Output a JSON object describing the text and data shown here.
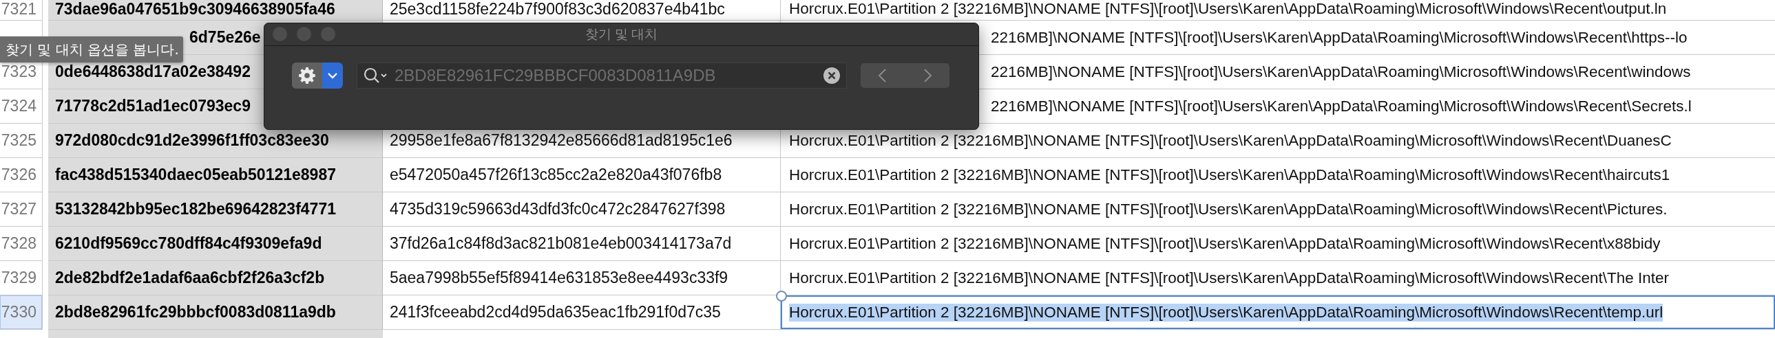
{
  "sheet": {
    "rows": [
      {
        "number": "7321",
        "selected": false,
        "column_1": "73dae96a047651b9c30946638905fa46",
        "column_2": "25e3cd1158fe224b7f900f83c3d620837e4b41bc",
        "column_3": "Horcrux.E01\\Partition 2 [32216MB]\\NONAME [NTFS]\\[root]\\Users\\Karen\\AppData\\Roaming\\Microsoft\\Windows\\Recent\\output.ln"
      },
      {
        "selected": false,
        "column_1": "6d75e26e",
        "column_3": "2216MB]\\NONAME [NTFS]\\[root]\\Users\\Karen\\AppData\\Roaming\\Microsoft\\Windows\\Recent\\https--lo"
      },
      {
        "number": "7323",
        "selected": false,
        "column_1": "0de6448638d17a02e38492",
        "column_3": "2216MB]\\NONAME [NTFS]\\[root]\\Users\\Karen\\AppData\\Roaming\\Microsoft\\Windows\\Recent\\windows"
      },
      {
        "number": "7324",
        "selected": false,
        "column_1": "71778c2d51ad1ec0793ec9",
        "column_3": "2216MB]\\NONAME [NTFS]\\[root]\\Users\\Karen\\AppData\\Roaming\\Microsoft\\Windows\\Recent\\Secrets.l"
      },
      {
        "number": "7325",
        "selected": false,
        "column_1": "972d080cdc91d2e3996f1ff03c83ee30",
        "column_2": "29958e1fe8a67f8132942e85666d81ad8195c1e6",
        "column_3": "Horcrux.E01\\Partition 2 [32216MB]\\NONAME [NTFS]\\[root]\\Users\\Karen\\AppData\\Roaming\\Microsoft\\Windows\\Recent\\DuanesC"
      },
      {
        "number": "7326",
        "selected": false,
        "column_1": "fac438d515340daec05eab50121e8987",
        "column_2": "e5472050a457f26f13c85cc2a2e820a43f076fb8",
        "column_3": "Horcrux.E01\\Partition 2 [32216MB]\\NONAME [NTFS]\\[root]\\Users\\Karen\\AppData\\Roaming\\Microsoft\\Windows\\Recent\\haircuts1"
      },
      {
        "number": "7327",
        "selected": false,
        "column_1": "53132842bb95ec182be69642823f4771",
        "column_2": "4735d319c59663d43dfd3fc0c472c2847627f398",
        "column_3": "Horcrux.E01\\Partition 2 [32216MB]\\NONAME [NTFS]\\[root]\\Users\\Karen\\AppData\\Roaming\\Microsoft\\Windows\\Recent\\Pictures."
      },
      {
        "number": "7328",
        "selected": false,
        "column_1": "6210df9569cc780dff84c4f9309efa9d",
        "column_2": "37fd26a1c84f8d3ac821b081e4eb003414173a7d",
        "column_3": "Horcrux.E01\\Partition 2 [32216MB]\\NONAME [NTFS]\\[root]\\Users\\Karen\\AppData\\Roaming\\Microsoft\\Windows\\Recent\\x88bidy"
      },
      {
        "number": "7329",
        "selected": false,
        "column_1": "2de82bdf2e1adaf6aa6cbf2f26a3cf2b",
        "column_2": "5aea7998b55ef5f89414e631853e8ee4493c33f9",
        "column_3": "Horcrux.E01\\Partition 2 [32216MB]\\NONAME [NTFS]\\[root]\\Users\\Karen\\AppData\\Roaming\\Microsoft\\Windows\\Recent\\The Inter"
      },
      {
        "number": "7330",
        "selected": true,
        "column_1": "2bd8e82961fc29bbbcf0083d0811a9db",
        "column_2": "241f3fceeabd2cd4d95da635eac1fb291f0d7c35",
        "column_3": "Horcrux.E01\\Partition 2 [32216MB]\\NONAME [NTFS]\\[root]\\Users\\Karen\\AppData\\Roaming\\Microsoft\\Windows\\Recent\\temp.url"
      }
    ]
  },
  "find_replace": {
    "title": "찾기 및 대치",
    "search": {
      "value": "2BD8E82961FC29BBBCF0083D0811A9DB"
    },
    "previous": {
      "disabled": true
    },
    "next": {
      "disabled": true
    }
  },
  "tooltip": {
    "text": "찾기 및 대치 옵션을 봅니다."
  }
}
